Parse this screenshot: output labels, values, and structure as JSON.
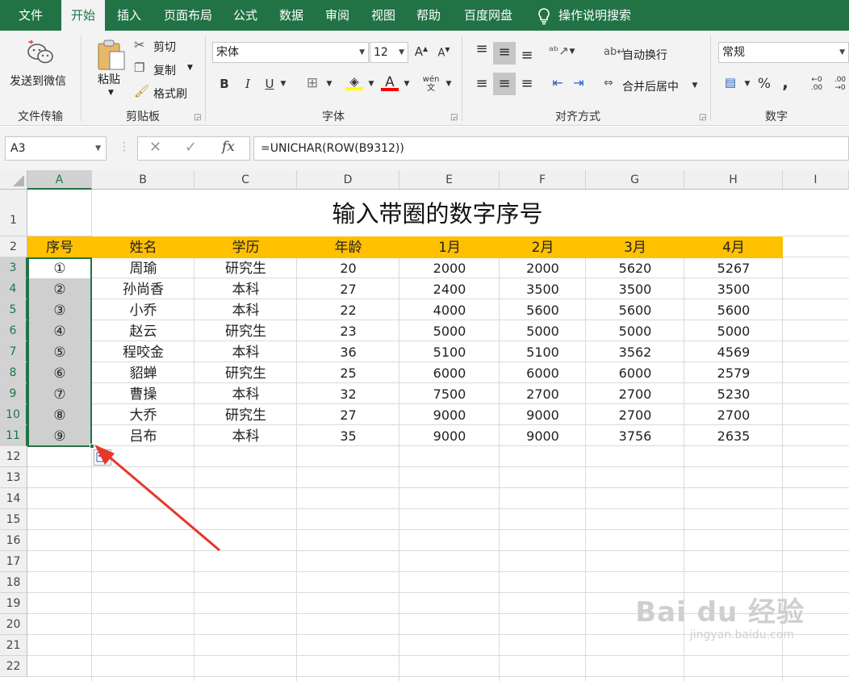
{
  "menu": {
    "file": "文件",
    "home": "开始",
    "insert": "插入",
    "layout": "页面布局",
    "formulas": "公式",
    "data": "数据",
    "review": "审阅",
    "view": "视图",
    "help": "帮助",
    "baidu": "百度网盘",
    "search": "操作说明搜索"
  },
  "ribbon": {
    "wechat": "发送到微信",
    "group_transfer": "文件传输",
    "paste": "粘贴",
    "cut": "剪切",
    "copy": "复制",
    "format_painter": "格式刷",
    "group_clipboard": "剪贴板",
    "font_name": "宋体",
    "font_size": "12",
    "bold": "B",
    "italic": "I",
    "underline": "U",
    "group_font": "字体",
    "wrap_text": "自动换行",
    "merge_center": "合并后居中",
    "group_align": "对齐方式",
    "number_format": "常规",
    "percent": "%",
    "comma": ",",
    "group_number": "数字"
  },
  "formula_bar": {
    "name_box": "A3",
    "fx": "fx",
    "formula": "=UNICHAR(ROW(B9312))"
  },
  "sheet": {
    "columns": [
      "A",
      "B",
      "C",
      "D",
      "E",
      "F",
      "G",
      "H",
      "I"
    ],
    "rows": [
      "1",
      "2",
      "3",
      "4",
      "5",
      "6",
      "7",
      "8",
      "9",
      "10",
      "11",
      "12",
      "13",
      "14",
      "15",
      "16",
      "17",
      "18",
      "19",
      "20",
      "21",
      "22"
    ],
    "title": "输入带圈的数字序号",
    "headers": [
      "序号",
      "姓名",
      "学历",
      "年龄",
      "1月",
      "2月",
      "3月",
      "4月"
    ],
    "data": [
      [
        "①",
        "周瑜",
        "研究生",
        "20",
        "2000",
        "2000",
        "5620",
        "5267"
      ],
      [
        "②",
        "孙尚香",
        "本科",
        "27",
        "2400",
        "3500",
        "3500",
        "3500"
      ],
      [
        "③",
        "小乔",
        "本科",
        "22",
        "4000",
        "5600",
        "5600",
        "5600"
      ],
      [
        "④",
        "赵云",
        "研究生",
        "23",
        "5000",
        "5000",
        "5000",
        "5000"
      ],
      [
        "⑤",
        "程咬金",
        "本科",
        "36",
        "5100",
        "5100",
        "3562",
        "4569"
      ],
      [
        "⑥",
        "貂蝉",
        "研究生",
        "25",
        "6000",
        "6000",
        "6000",
        "2579"
      ],
      [
        "⑦",
        "曹操",
        "本科",
        "32",
        "7500",
        "2700",
        "2700",
        "5230"
      ],
      [
        "⑧",
        "大乔",
        "研究生",
        "27",
        "9000",
        "9000",
        "2700",
        "2700"
      ],
      [
        "⑨",
        "吕布",
        "本科",
        "35",
        "9000",
        "9000",
        "3756",
        "2635"
      ]
    ]
  },
  "watermark": {
    "brand": "Bai du 经验",
    "url": "jingyan.baidu.com"
  },
  "colors": {
    "excel_green": "#217346",
    "header_fill": "#ffc000",
    "arrow": "#e8362a"
  }
}
